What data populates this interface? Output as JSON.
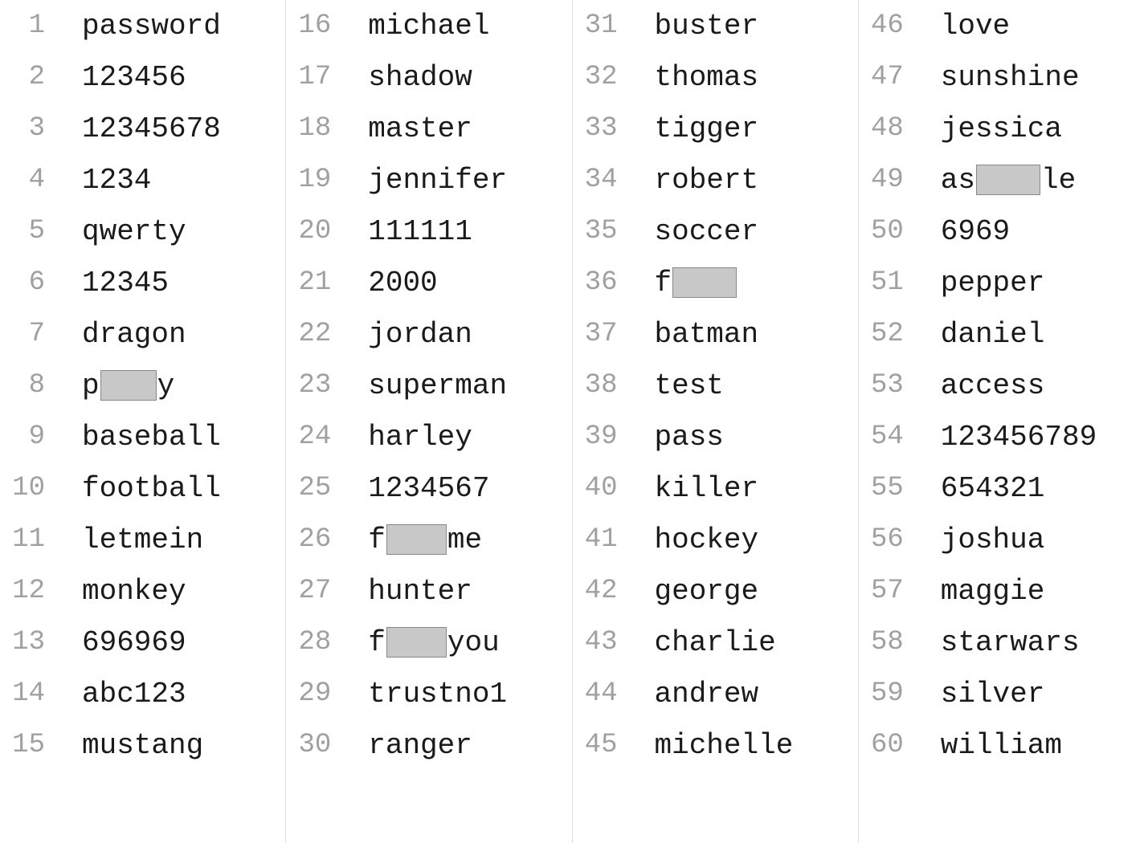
{
  "entries": [
    {
      "num": "1",
      "text": "password",
      "redacted": false
    },
    {
      "num": "2",
      "text": "123456",
      "redacted": false
    },
    {
      "num": "3",
      "text": "12345678",
      "redacted": false
    },
    {
      "num": "4",
      "text": "1234",
      "redacted": false
    },
    {
      "num": "5",
      "text": "qwerty",
      "redacted": false
    },
    {
      "num": "6",
      "text": "12345",
      "redacted": false
    },
    {
      "num": "7",
      "text": "dragon",
      "redacted": false
    },
    {
      "num": "8",
      "text": "p___y",
      "redacted": true,
      "prefix": "p",
      "suffix": "y",
      "width": "w70"
    },
    {
      "num": "9",
      "text": "baseball",
      "redacted": false
    },
    {
      "num": "10",
      "text": "football",
      "redacted": false
    },
    {
      "num": "11",
      "text": "letmein",
      "redacted": false
    },
    {
      "num": "12",
      "text": "monkey",
      "redacted": false
    },
    {
      "num": "13",
      "text": "696969",
      "redacted": false
    },
    {
      "num": "14",
      "text": "abc123",
      "redacted": false
    },
    {
      "num": "15",
      "text": "mustang",
      "redacted": false
    },
    {
      "num": "16",
      "text": "michael",
      "redacted": false
    },
    {
      "num": "17",
      "text": "shadow",
      "redacted": false
    },
    {
      "num": "18",
      "text": "master",
      "redacted": false
    },
    {
      "num": "19",
      "text": "jennifer",
      "redacted": false
    },
    {
      "num": "20",
      "text": "111111",
      "redacted": false
    },
    {
      "num": "21",
      "text": "2000",
      "redacted": false
    },
    {
      "num": "22",
      "text": "jordan",
      "redacted": false
    },
    {
      "num": "23",
      "text": "superman",
      "redacted": false
    },
    {
      "num": "24",
      "text": "harley",
      "redacted": false
    },
    {
      "num": "25",
      "text": "1234567",
      "redacted": false
    },
    {
      "num": "26",
      "text": "f___me",
      "redacted": true,
      "prefix": "f",
      "suffix": "me",
      "width": "w75"
    },
    {
      "num": "27",
      "text": "hunter",
      "redacted": false
    },
    {
      "num": "28",
      "text": "f___you",
      "redacted": true,
      "prefix": "f",
      "suffix": "you",
      "width": "w75"
    },
    {
      "num": "29",
      "text": "trustno1",
      "redacted": false
    },
    {
      "num": "30",
      "text": "ranger",
      "redacted": false
    },
    {
      "num": "31",
      "text": "buster",
      "redacted": false
    },
    {
      "num": "32",
      "text": "thomas",
      "redacted": false
    },
    {
      "num": "33",
      "text": "tigger",
      "redacted": false
    },
    {
      "num": "34",
      "text": "robert",
      "redacted": false
    },
    {
      "num": "35",
      "text": "soccer",
      "redacted": false
    },
    {
      "num": "36",
      "text": "f___",
      "redacted": true,
      "prefix": "f",
      "suffix": "",
      "width": "w80"
    },
    {
      "num": "37",
      "text": "batman",
      "redacted": false
    },
    {
      "num": "38",
      "text": "test",
      "redacted": false
    },
    {
      "num": "39",
      "text": "pass",
      "redacted": false
    },
    {
      "num": "40",
      "text": "killer",
      "redacted": false
    },
    {
      "num": "41",
      "text": "hockey",
      "redacted": false
    },
    {
      "num": "42",
      "text": "george",
      "redacted": false
    },
    {
      "num": "43",
      "text": "charlie",
      "redacted": false
    },
    {
      "num": "44",
      "text": "andrew",
      "redacted": false
    },
    {
      "num": "45",
      "text": "michelle",
      "redacted": false
    },
    {
      "num": "46",
      "text": "love",
      "redacted": false
    },
    {
      "num": "47",
      "text": "sunshine",
      "redacted": false
    },
    {
      "num": "48",
      "text": "jessica",
      "redacted": false
    },
    {
      "num": "49",
      "text": "as___le",
      "redacted": true,
      "prefix": "as",
      "suffix": "le",
      "width": "w80"
    },
    {
      "num": "50",
      "text": "6969",
      "redacted": false
    },
    {
      "num": "51",
      "text": "pepper",
      "redacted": false
    },
    {
      "num": "52",
      "text": "daniel",
      "redacted": false
    },
    {
      "num": "53",
      "text": "access",
      "redacted": false
    },
    {
      "num": "54",
      "text": "123456789",
      "redacted": false
    },
    {
      "num": "55",
      "text": "654321",
      "redacted": false
    },
    {
      "num": "56",
      "text": "joshua",
      "redacted": false
    },
    {
      "num": "57",
      "text": "maggie",
      "redacted": false
    },
    {
      "num": "58",
      "text": "starwars",
      "redacted": false
    },
    {
      "num": "59",
      "text": "silver",
      "redacted": false
    },
    {
      "num": "60",
      "text": "william",
      "redacted": false
    }
  ],
  "columns": 4,
  "rowsPerColumn": 15
}
